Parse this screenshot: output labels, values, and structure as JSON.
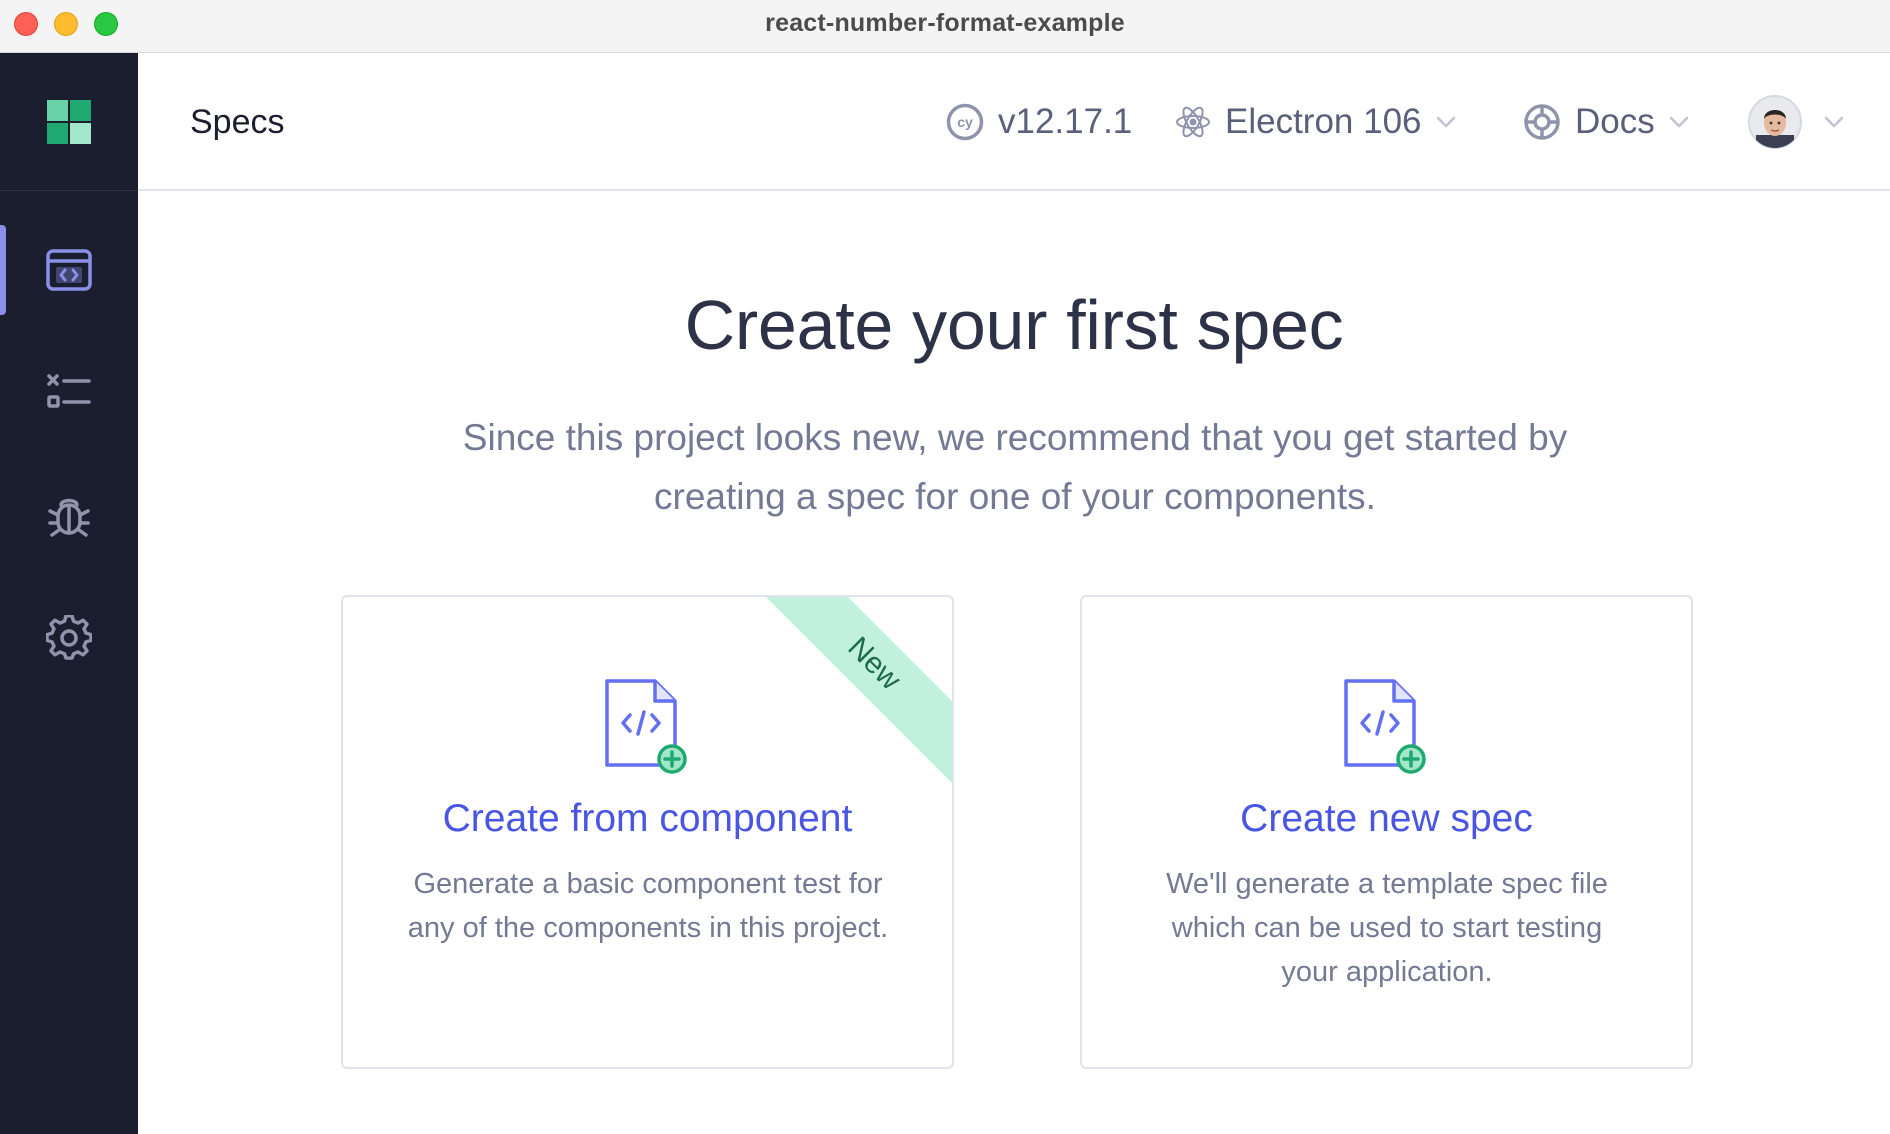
{
  "window": {
    "title": "react-number-format-example"
  },
  "header": {
    "title": "Specs",
    "version": "v12.17.1",
    "browser": "Electron 106",
    "docs": "Docs"
  },
  "sidebar": {
    "items": [
      {
        "name": "specs",
        "icon": "code-window-icon",
        "active": true
      },
      {
        "name": "runs",
        "icon": "test-results-icon",
        "active": false
      },
      {
        "name": "debug",
        "icon": "bug-icon",
        "active": false
      },
      {
        "name": "settings",
        "icon": "gear-icon",
        "active": false
      }
    ]
  },
  "main": {
    "title": "Create your first spec",
    "description": "Since this project looks new, we recommend that you get started by creating a spec for one of your components.",
    "cards": [
      {
        "title": "Create from component",
        "description": "Generate a basic component test for any of the components in this project.",
        "badge": "New"
      },
      {
        "title": "Create new spec",
        "description": "We'll generate a template spec file which can be used to start testing your application."
      }
    ]
  },
  "colors": {
    "sidebar_bg": "#1b1e2e",
    "accent": "#4956e3",
    "icon_indigo": "#6470f3",
    "badge_green": "#c1f1dd",
    "plus_green": "#1fa971"
  }
}
